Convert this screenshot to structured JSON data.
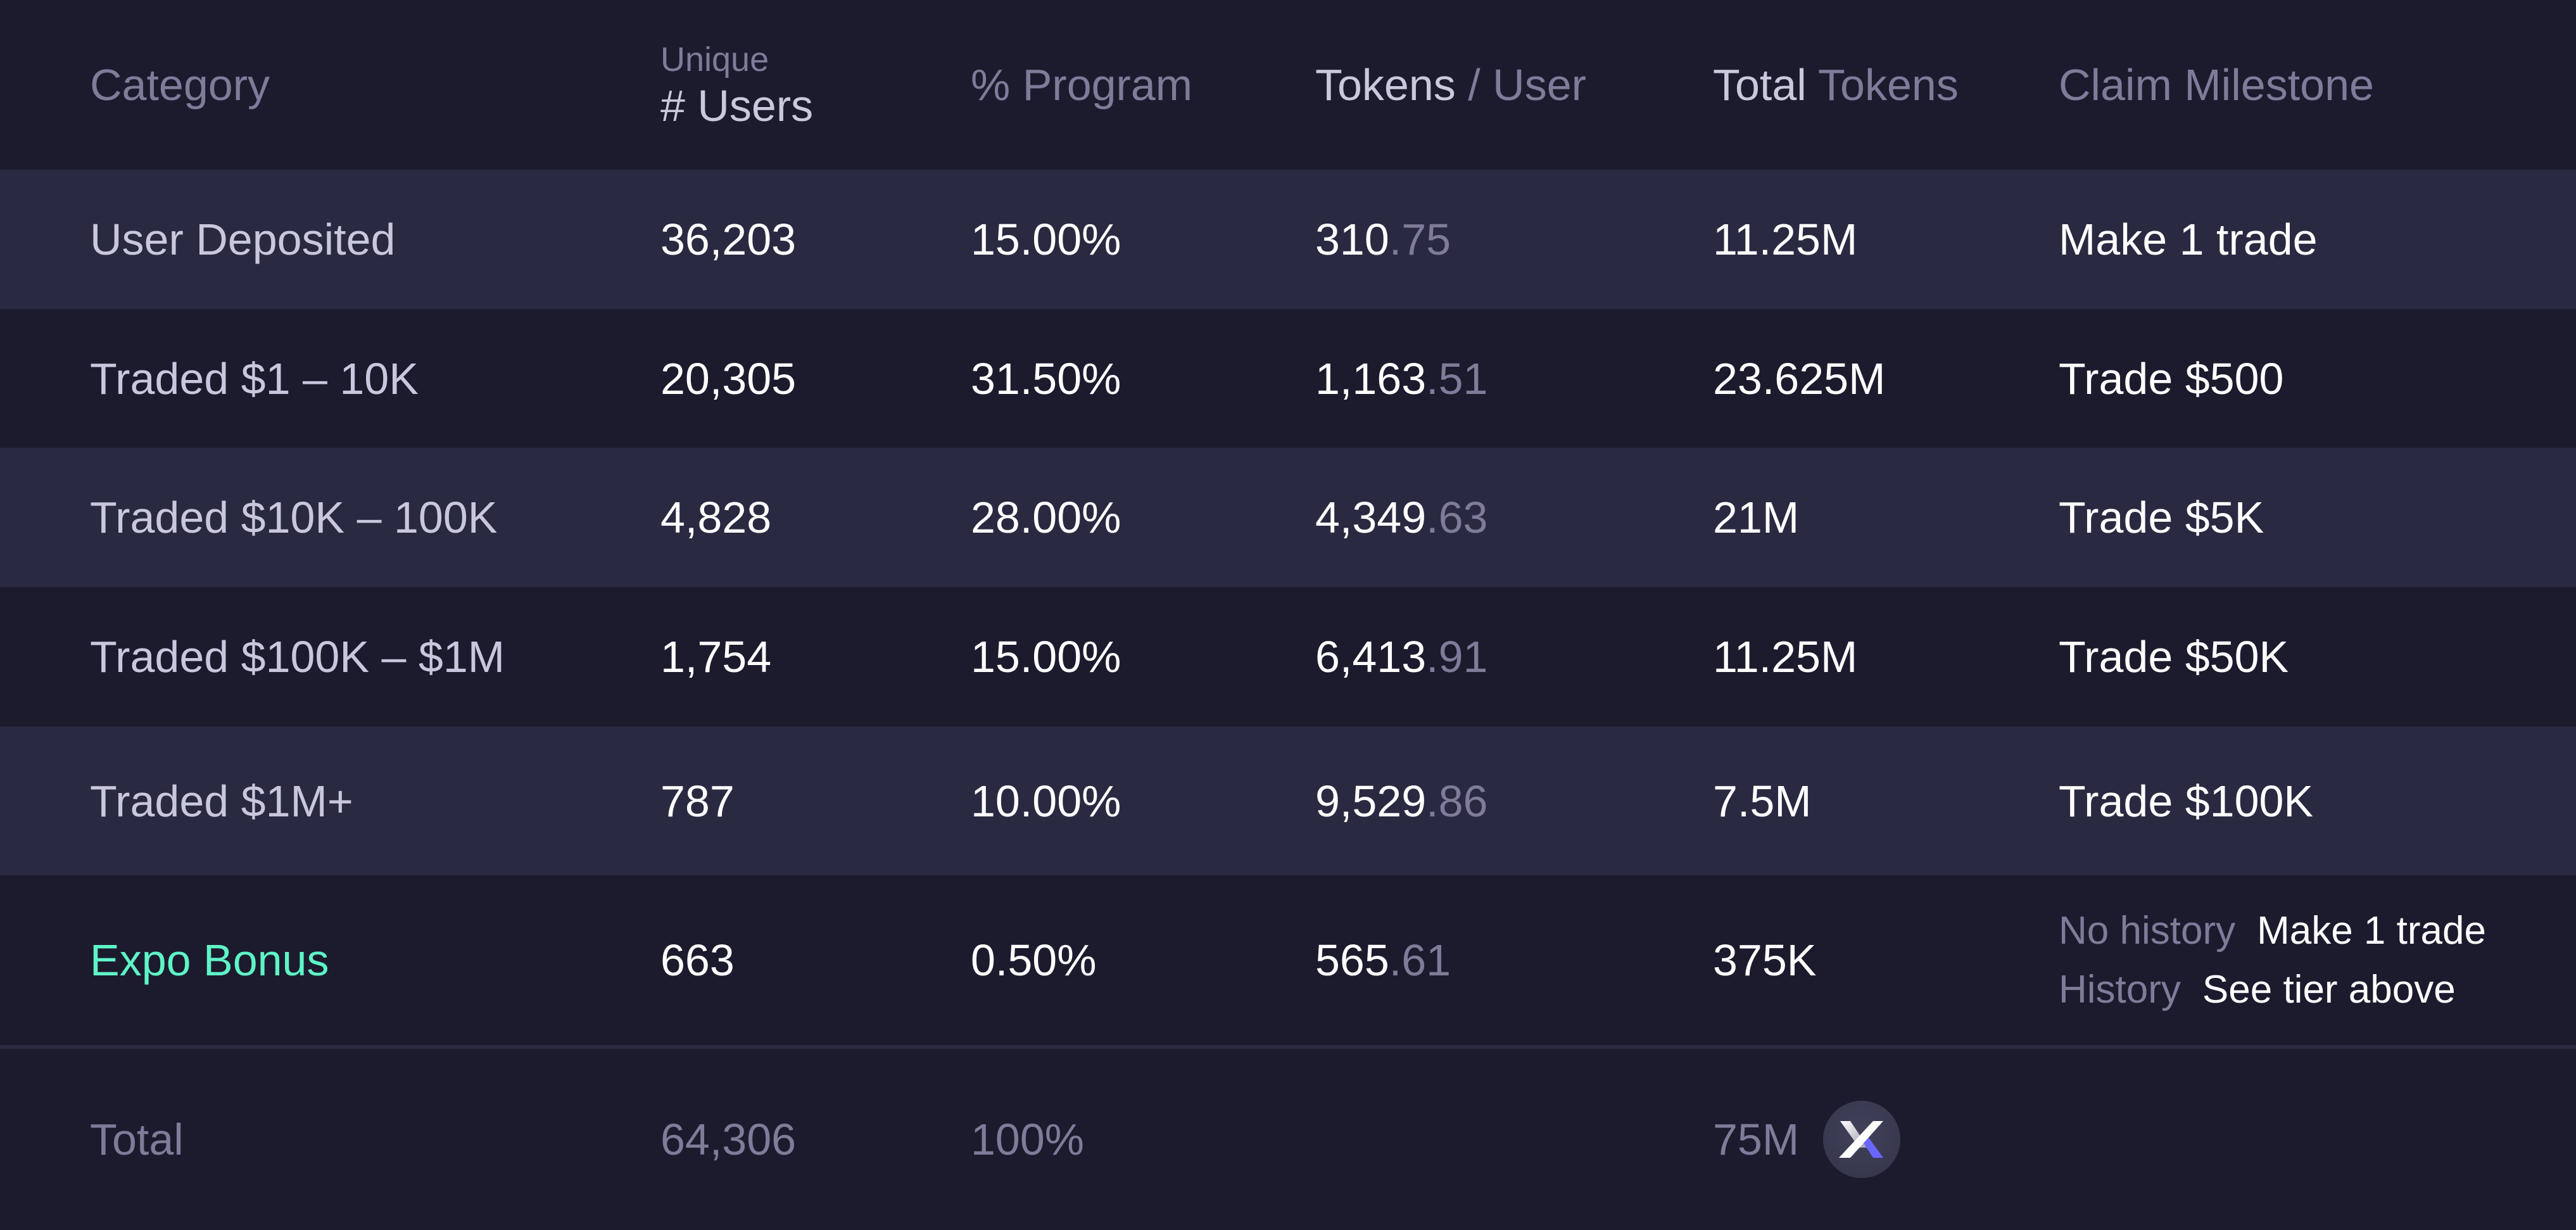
{
  "header": {
    "category": "Category",
    "users_small": "Unique",
    "users_big": "# Users",
    "program": "% Program",
    "tokens_user_bright": "Tokens",
    "tokens_user_dim": " / User",
    "total_tokens_bright": "Total",
    "total_tokens_dim": " Tokens",
    "claim": "Claim Milestone"
  },
  "rows": [
    {
      "category": "User Deposited",
      "users": "36,203",
      "program": "15.00%",
      "tpu_int": "310",
      "tpu_dec": ".75",
      "total": "11.25M",
      "milestone": "Make 1 trade"
    },
    {
      "category": "Traded $1 – 10K",
      "users": "20,305",
      "program": "31.50%",
      "tpu_int": "1,163",
      "tpu_dec": ".51",
      "total": "23.625M",
      "milestone": "Trade $500"
    },
    {
      "category": "Traded $10K – 100K",
      "users": "4,828",
      "program": "28.00%",
      "tpu_int": "4,349",
      "tpu_dec": ".63",
      "total": "21M",
      "milestone": "Trade $5K"
    },
    {
      "category": "Traded $100K – $1M",
      "users": "1,754",
      "program": "15.00%",
      "tpu_int": "6,413",
      "tpu_dec": ".91",
      "total": "11.25M",
      "milestone": "Trade $50K"
    },
    {
      "category": "Traded $1M+",
      "users": "787",
      "program": "10.00%",
      "tpu_int": "9,529",
      "tpu_dec": ".86",
      "total": "7.5M",
      "milestone": "Trade $100K"
    }
  ],
  "bonus": {
    "category": "Expo Bonus",
    "users": "663",
    "program": "0.50%",
    "tpu_int": "565",
    "tpu_dec": ".61",
    "total": "375K",
    "milestones": [
      {
        "label": "No history",
        "value": "Make 1 trade"
      },
      {
        "label": "History",
        "value": "See tier above"
      }
    ],
    "accent_color": "#5ef5c6"
  },
  "footer": {
    "label": "Total",
    "users": "64,306",
    "program": "100%",
    "total": "75M",
    "token_icon": "dydx-x-logo-icon"
  }
}
